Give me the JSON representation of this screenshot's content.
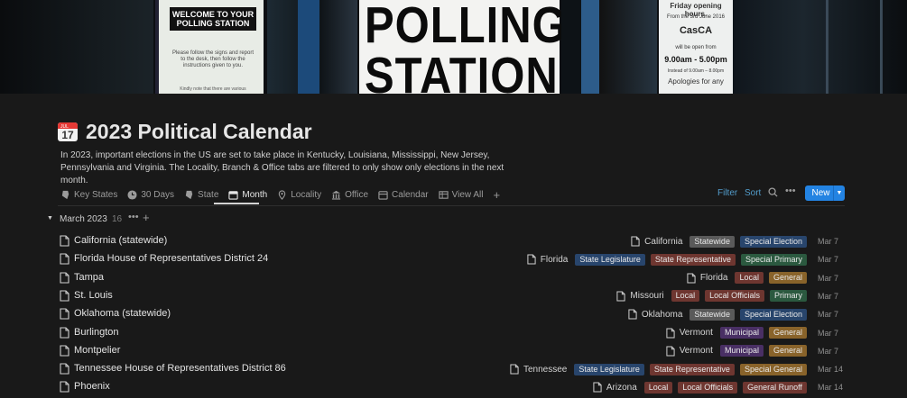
{
  "cover": {
    "sign1_title": "WELCOME TO YOUR POLLING STATION",
    "sign1_text": "Please follow the signs and report to the desk, then follow the instructions given to you.",
    "sign1_foot": "Kindly note that there are various",
    "poll_line1": "POLLING",
    "poll_line2": "STATION",
    "sign2_l1": "Friday opening hours.",
    "sign2_l2": "From the 3rd June 2016",
    "sign2_l3": "CasCA",
    "sign2_l4": "will be open from",
    "sign2_l5": "9.00am - 5.00pm",
    "sign2_l6": "Instead of 9.00am – 8.00pm",
    "sign2_l7": "Apologies for any"
  },
  "page": {
    "title": "2023 Political Calendar",
    "icon": "calendar-icon",
    "description": "In 2023, important elections in the US are set to take place in Kentucky, Louisiana, Mississippi, New Jersey, Pennsylvania and Virginia. The Locality, Branch & Office tabs are filtered to only show only elections in the next month."
  },
  "tabs": [
    {
      "label": "Key States",
      "icon": "state-icon"
    },
    {
      "label": "30 Days",
      "icon": "clock-icon"
    },
    {
      "label": "State",
      "icon": "state-icon"
    },
    {
      "label": "Month",
      "icon": "calendar-icon"
    },
    {
      "label": "Locality",
      "icon": "pin-icon"
    },
    {
      "label": "Office",
      "icon": "building-icon"
    },
    {
      "label": "Calendar",
      "icon": "calendar-icon"
    },
    {
      "label": "View All",
      "icon": "table-icon"
    }
  ],
  "active_tab": "Month",
  "toolbar": {
    "filter_label": "Filter",
    "sort_label": "Sort",
    "more_label": "•••",
    "new_label": "New"
  },
  "group": {
    "name": "March 2023",
    "count": "16",
    "more_label": "•••",
    "add_label": "+"
  },
  "colors": {
    "Statewide": "#5a5a5a",
    "Special Election": "#28456c",
    "State Legislature": "#28456c",
    "State Representative": "#6e3630",
    "Special Primary": "#2b593f",
    "Local": "#6e3630",
    "General": "#89632a",
    "Local Officials": "#6e3630",
    "Primary": "#2b593f",
    "Municipal": "#492f64",
    "Special General": "#89632a",
    "General Runoff": "#6e3630"
  },
  "rows": [
    {
      "name": "California (statewide)",
      "location": "California",
      "tags": [
        "Statewide",
        "Special Election"
      ],
      "date": "Mar 7"
    },
    {
      "name": "Florida House of Representatives District 24",
      "location": "Florida",
      "tags": [
        "State Legislature",
        "State Representative",
        "Special Primary"
      ],
      "date": "Mar 7"
    },
    {
      "name": "Tampa",
      "location": "Florida",
      "tags": [
        "Local",
        "General"
      ],
      "date": "Mar 7"
    },
    {
      "name": "St. Louis",
      "location": "Missouri",
      "tags": [
        "Local",
        "Local Officials",
        "Primary"
      ],
      "date": "Mar 7"
    },
    {
      "name": "Oklahoma (statewide)",
      "location": "Oklahoma",
      "tags": [
        "Statewide",
        "Special Election"
      ],
      "date": "Mar 7"
    },
    {
      "name": "Burlington",
      "location": "Vermont",
      "tags": [
        "Municipal",
        "General"
      ],
      "date": "Mar 7"
    },
    {
      "name": "Montpelier",
      "location": "Vermont",
      "tags": [
        "Municipal",
        "General"
      ],
      "date": "Mar 7"
    },
    {
      "name": "Tennessee House of Representatives District 86",
      "location": "Tennessee",
      "tags": [
        "State Legislature",
        "State Representative",
        "Special General"
      ],
      "date": "Mar 14"
    },
    {
      "name": "Phoenix",
      "location": "Arizona",
      "tags": [
        "Local",
        "Local Officials",
        "General Runoff"
      ],
      "date": "Mar 14"
    }
  ]
}
